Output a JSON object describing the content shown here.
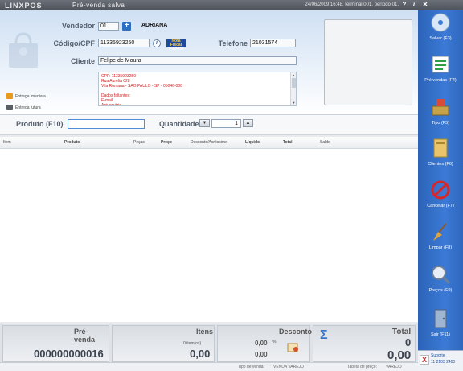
{
  "titlebar": {
    "brand": "LINXPOS",
    "mode": "Pré-venda salva",
    "status": "24/06/2009 16:48, terminal 001, período 01,",
    "help": "?",
    "info": "i",
    "close": "✕"
  },
  "header": {
    "vendedor_label": "Vendedor",
    "vendedor_value": "01",
    "vendedor_name": "ADRIANA",
    "add_label": "+",
    "cpf_label": "Código/CPF",
    "cpf_value": "11335923250",
    "info_icon": "i",
    "nota_line1": "Nota Fiscal",
    "nota_line2": "Paulista",
    "telefone_label": "Telefone",
    "telefone_value": "21031574",
    "cliente_label": "Cliente",
    "cliente_value": "Felipe de Moura",
    "memo_lines": [
      "CPF: 11335923250",
      "Rua Aurelia 628",
      "Vila Romana - SAO PAULO - SP - 05046-000",
      "",
      "Dados faltantes:",
      "E-mail",
      "Aniversário"
    ],
    "entrega_imediata": "Entrega imediata",
    "entrega_futura": "Entrega futura"
  },
  "product": {
    "produto_label": "Produto (F10)",
    "produto_value": "",
    "quantidade_label": "Quantidade",
    "quantidade_value": "1",
    "down": "▼",
    "up": "▲"
  },
  "grid": {
    "columns": [
      "Item",
      "Produto",
      "Peças",
      "Preço",
      "Desconto/Acréscimo",
      "Líquido",
      "Total",
      "Saldo"
    ],
    "rows": []
  },
  "totals": {
    "prevenda_title": "Pré-venda",
    "prevenda_value": "000000000016",
    "itens_title": "Itens",
    "itens_count": "0 item(ns)",
    "itens_value": "0,00",
    "desconto_title": "Desconto",
    "desconto_pct": "0,00",
    "pct_symbol": "%",
    "desconto_value": "0,00",
    "total_title": "Total",
    "total_count": "0",
    "total_value": "0,00",
    "sigma": "Σ"
  },
  "statusbar": {
    "tipo_venda_label": "Tipo de venda:",
    "tipo_venda_value": "VENDA VAREJO",
    "tabela_label": "Tabela de preço:",
    "tabela_value": "VAREJO"
  },
  "toolbar": {
    "items": [
      {
        "label": "Salvar (F3)",
        "icon": "save-disc-icon"
      },
      {
        "label": "Pré vendas (F4)",
        "icon": "presales-icon"
      },
      {
        "label": "Tipo (F5)",
        "icon": "type-icon"
      },
      {
        "label": "Clientes (F6)",
        "icon": "clients-icon"
      },
      {
        "label": "Cancelar (F7)",
        "icon": "cancel-icon"
      },
      {
        "label": "Limpar (F8)",
        "icon": "broom-icon"
      },
      {
        "label": "Preços (F9)",
        "icon": "prices-icon"
      },
      {
        "label": "Sair (F11)",
        "icon": "exit-door-icon"
      }
    ],
    "support_line1": "Suporte",
    "support_line2": "11 2103 2400"
  },
  "colors": {
    "toolbar_blue": "#3b7ad6",
    "memo_red": "#d21d1d",
    "header_gradient_top": "#cfe0f3"
  }
}
